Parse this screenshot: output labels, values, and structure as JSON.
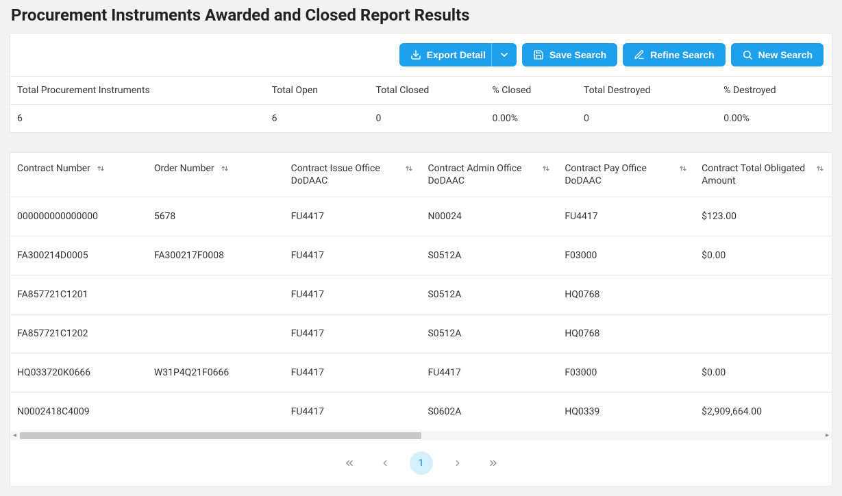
{
  "page": {
    "title": "Procurement Instruments Awarded and Closed Report Results"
  },
  "toolbar": {
    "export_detail_label": "Export Detail",
    "save_search_label": "Save Search",
    "refine_search_label": "Refine Search",
    "new_search_label": "New Search"
  },
  "summary": {
    "headers": {
      "total_instruments": "Total Procurement Instruments",
      "total_open": "Total Open",
      "total_closed": "Total Closed",
      "pct_closed": "% Closed",
      "total_destroyed": "Total Destroyed",
      "pct_destroyed": "% Destroyed"
    },
    "values": {
      "total_instruments": "6",
      "total_open": "6",
      "total_closed": "0",
      "pct_closed": "0.00%",
      "total_destroyed": "0",
      "pct_destroyed": "0.00%"
    }
  },
  "table": {
    "headers": {
      "contract_number": "Contract Number",
      "order_number": "Order Number",
      "contract_issue_office": "Contract Issue Office DoDAAC",
      "contract_admin_office": "Contract Admin Office DoDAAC",
      "contract_pay_office": "Contract Pay Office DoDAAC",
      "contract_total_obligated": "Contract Total Obligated Amount"
    },
    "rows": [
      {
        "contract_number": "000000000000000",
        "order_number": "5678",
        "issue_office": "FU4417",
        "admin_office": "N00024",
        "pay_office": "FU4417",
        "total_obligated": "$123.00"
      },
      {
        "contract_number": "FA300214D0005",
        "order_number": "FA300217F0008",
        "issue_office": "FU4417",
        "admin_office": "S0512A",
        "pay_office": "F03000",
        "total_obligated": "$0.00"
      },
      {
        "contract_number": "FA857721C1201",
        "order_number": "",
        "issue_office": "FU4417",
        "admin_office": "S0512A",
        "pay_office": "HQ0768",
        "total_obligated": ""
      },
      {
        "contract_number": "FA857721C1202",
        "order_number": "",
        "issue_office": "FU4417",
        "admin_office": "S0512A",
        "pay_office": "HQ0768",
        "total_obligated": ""
      },
      {
        "contract_number": "HQ033720K0666",
        "order_number": "W31P4Q21F0666",
        "issue_office": "FU4417",
        "admin_office": "FU4417",
        "pay_office": "F03000",
        "total_obligated": "$0.00"
      },
      {
        "contract_number": "N0002418C4009",
        "order_number": "",
        "issue_office": "FU4417",
        "admin_office": "S0602A",
        "pay_office": "HQ0339",
        "total_obligated": "$2,909,664.00"
      }
    ]
  },
  "pagination": {
    "current": "1"
  }
}
